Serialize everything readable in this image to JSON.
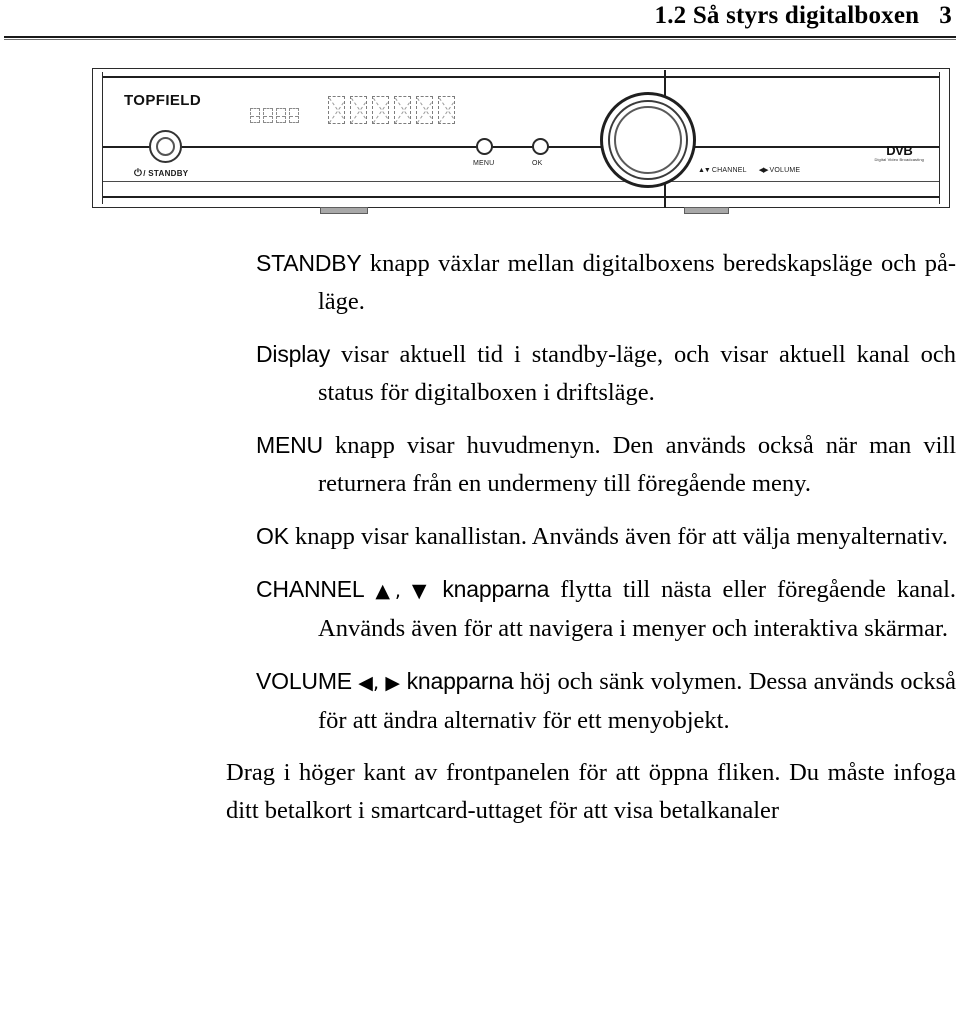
{
  "header": {
    "section_number": "1.2",
    "title": "1.2 Så styrs digitalboxen",
    "page_number": "3"
  },
  "figure": {
    "brand": "TOPFIELD",
    "standby_label": "/ STANDBY",
    "power_glyph": "⏻",
    "menu_caption": "MENU",
    "ok_caption": "OK",
    "channel_caption": "CHANNEL",
    "volume_caption": "VOLUME",
    "channel_arrows": "▲▼",
    "volume_arrows": "◀▶",
    "dvb_mark": "DVB",
    "dvb_sub": "Digital Video Broadcasting",
    "led_small_cells": 4,
    "led_big_cells": 6
  },
  "body": {
    "paragraphs": [
      {
        "keyword": "STANDBY",
        "text": " knapp växlar mellan digitalboxens beredskapsläge och på-läge."
      },
      {
        "keyword": "Display",
        "text": " visar aktuell tid i standby-läge, och visar aktuell kanal och status för digitalboxen i driftsläge."
      },
      {
        "keyword": "MENU",
        "text": " knapp visar huvudmenyn. Den används också när man vill returnera från en undermeny till föregående meny."
      },
      {
        "keyword": "OK",
        "text": " knapp visar kanallistan. Används även för att välja menyalternativ."
      },
      {
        "keyword": "CHANNEL",
        "arrows": " ▲, ▼",
        "text": " knapparna flytta till nästa eller föregående kanal. Används även för att navigera i menyer och interaktiva skärmar."
      },
      {
        "keyword": "VOLUME",
        "arrows": " ◀, ▶",
        "text": " knapparna höj och sänk volymen. Dessa används också för att ändra alternativ för ett menyobjekt."
      },
      {
        "keyword": "",
        "text": "Drag i höger kant av frontpanelen för att öppna fliken. Du måste infoga ditt betalkort i smartcard-uttaget för att visa betalkanaler"
      }
    ]
  },
  "colors": {
    "text": "#000000",
    "rule": "#1a1a1a",
    "page_background": "#ffffff",
    "device_outline": "#2b2b2b",
    "led_segment": "#8a8a8a"
  }
}
